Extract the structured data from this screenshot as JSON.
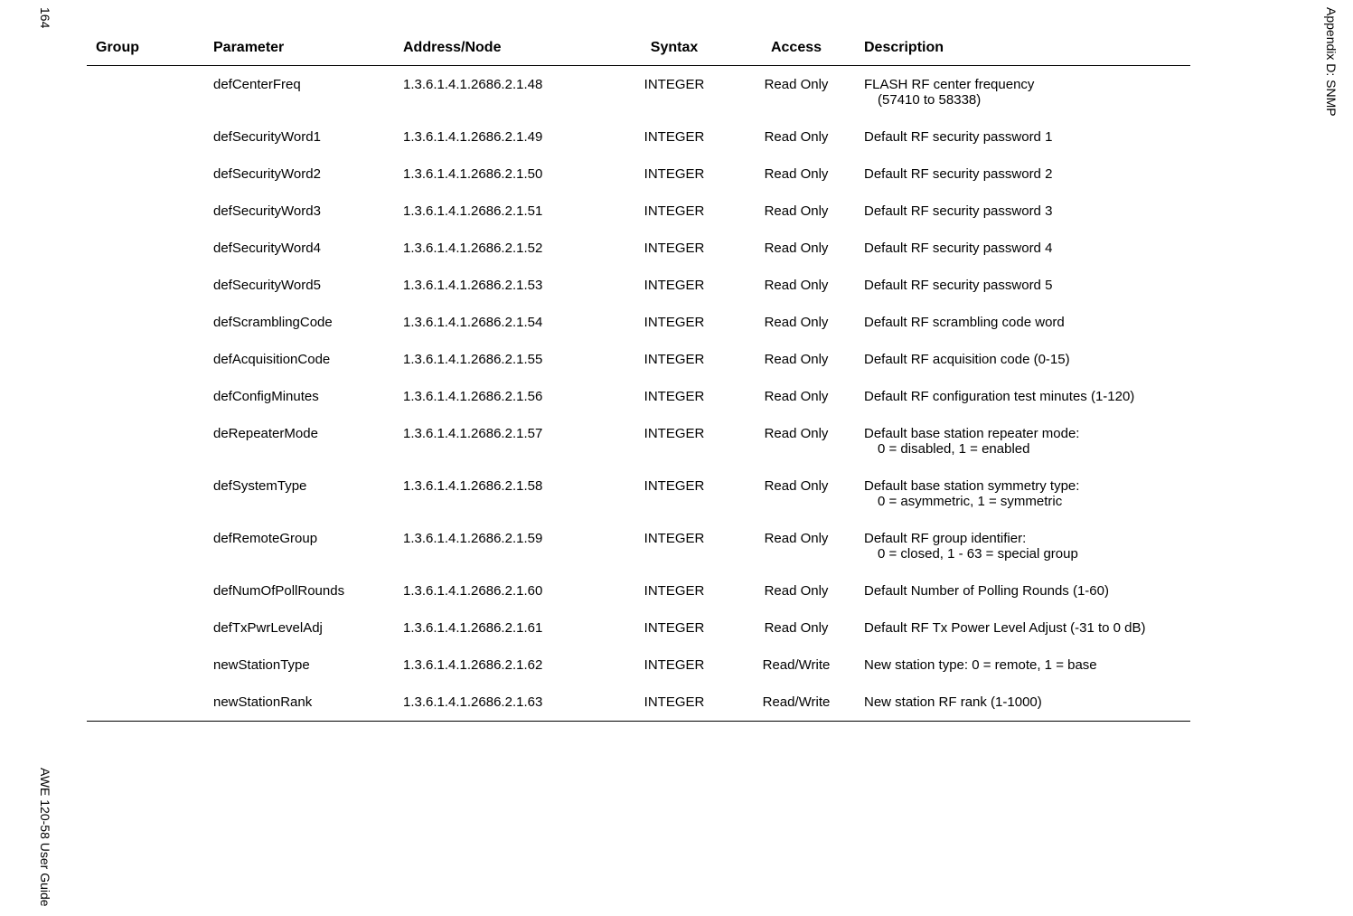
{
  "page_number": "164",
  "header_right": "Appendix D: SNMP",
  "footer_left": "AWE 120-58 User Guide",
  "columns": {
    "group": "Group",
    "parameter": "Parameter",
    "address": "Address/Node",
    "syntax": "Syntax",
    "access": "Access",
    "description": "Description"
  },
  "rows": [
    {
      "group": "",
      "parameter": "defCenterFreq",
      "address": "1.3.6.1.4.1.2686.2.1.48",
      "syntax": "INTEGER",
      "access": "Read Only",
      "description": "FLASH RF center frequency",
      "description2": "(57410 to 58338)"
    },
    {
      "group": "",
      "parameter": "defSecurityWord1",
      "address": "1.3.6.1.4.1.2686.2.1.49",
      "syntax": "INTEGER",
      "access": "Read Only",
      "description": "Default RF security password 1"
    },
    {
      "group": "",
      "parameter": "defSecurityWord2",
      "address": "1.3.6.1.4.1.2686.2.1.50",
      "syntax": "INTEGER",
      "access": "Read Only",
      "description": "Default RF security password 2"
    },
    {
      "group": "",
      "parameter": "defSecurityWord3",
      "address": "1.3.6.1.4.1.2686.2.1.51",
      "syntax": "INTEGER",
      "access": "Read Only",
      "description": "Default RF security password 3"
    },
    {
      "group": "",
      "parameter": "defSecurityWord4",
      "address": "1.3.6.1.4.1.2686.2.1.52",
      "syntax": "INTEGER",
      "access": "Read Only",
      "description": "Default RF security password 4"
    },
    {
      "group": "",
      "parameter": "defSecurityWord5",
      "address": "1.3.6.1.4.1.2686.2.1.53",
      "syntax": "INTEGER",
      "access": "Read Only",
      "description": "Default RF security password 5"
    },
    {
      "group": "",
      "parameter": "defScramblingCode",
      "address": "1.3.6.1.4.1.2686.2.1.54",
      "syntax": "INTEGER",
      "access": "Read Only",
      "description": "Default RF scrambling code word"
    },
    {
      "group": "",
      "parameter": "defAcquisitionCode",
      "address": "1.3.6.1.4.1.2686.2.1.55",
      "syntax": "INTEGER",
      "access": "Read Only",
      "description": "Default RF acquisition code (0-15)"
    },
    {
      "group": "",
      "parameter": "defConfigMinutes",
      "address": "1.3.6.1.4.1.2686.2.1.56",
      "syntax": "INTEGER",
      "access": "Read Only",
      "description": "Default RF configuration test minutes (1-120)"
    },
    {
      "group": "",
      "parameter": "deRepeaterMode",
      "address": "1.3.6.1.4.1.2686.2.1.57",
      "syntax": "INTEGER",
      "access": "Read Only",
      "description": "Default base station repeater mode:",
      "description2": "0 = disabled, 1 = enabled"
    },
    {
      "group": "",
      "parameter": "defSystemType",
      "address": "1.3.6.1.4.1.2686.2.1.58",
      "syntax": "INTEGER",
      "access": "Read Only",
      "description": "Default base station symmetry type:",
      "description2": "0 = asymmetric, 1 = symmetric"
    },
    {
      "group": "",
      "parameter": "defRemoteGroup",
      "address": "1.3.6.1.4.1.2686.2.1.59",
      "syntax": "INTEGER",
      "access": "Read Only",
      "description": "Default RF group identifier:",
      "description2": "0 = closed, 1 - 63 = special group"
    },
    {
      "group": "",
      "parameter": "defNumOfPollRounds",
      "address": "1.3.6.1.4.1.2686.2.1.60",
      "syntax": "INTEGER",
      "access": "Read Only",
      "description": "Default Number of Polling Rounds (1-60)"
    },
    {
      "group": "",
      "parameter": "defTxPwrLevelAdj",
      "address": "1.3.6.1.4.1.2686.2.1.61",
      "syntax": "INTEGER",
      "access": "Read Only",
      "description": "Default RF Tx Power Level Adjust (-31 to 0 dB)"
    },
    {
      "group": "",
      "parameter": "newStationType",
      "address": "1.3.6.1.4.1.2686.2.1.62",
      "syntax": "INTEGER",
      "access": "Read/Write",
      "description": "New station type: 0 = remote, 1 = base"
    },
    {
      "group": "",
      "parameter": "newStationRank",
      "address": "1.3.6.1.4.1.2686.2.1.63",
      "syntax": "INTEGER",
      "access": "Read/Write",
      "description": "New station RF rank (1-1000)"
    }
  ]
}
